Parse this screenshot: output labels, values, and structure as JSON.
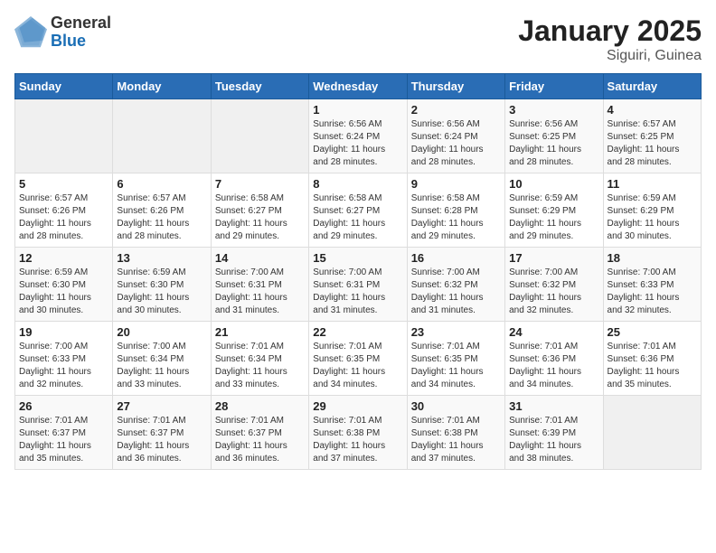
{
  "header": {
    "logo_general": "General",
    "logo_blue": "Blue",
    "title": "January 2025",
    "subtitle": "Siguiri, Guinea"
  },
  "calendar": {
    "days_of_week": [
      "Sunday",
      "Monday",
      "Tuesday",
      "Wednesday",
      "Thursday",
      "Friday",
      "Saturday"
    ],
    "weeks": [
      [
        {
          "num": "",
          "info": ""
        },
        {
          "num": "",
          "info": ""
        },
        {
          "num": "",
          "info": ""
        },
        {
          "num": "1",
          "info": "Sunrise: 6:56 AM\nSunset: 6:24 PM\nDaylight: 11 hours\nand 28 minutes."
        },
        {
          "num": "2",
          "info": "Sunrise: 6:56 AM\nSunset: 6:24 PM\nDaylight: 11 hours\nand 28 minutes."
        },
        {
          "num": "3",
          "info": "Sunrise: 6:56 AM\nSunset: 6:25 PM\nDaylight: 11 hours\nand 28 minutes."
        },
        {
          "num": "4",
          "info": "Sunrise: 6:57 AM\nSunset: 6:25 PM\nDaylight: 11 hours\nand 28 minutes."
        }
      ],
      [
        {
          "num": "5",
          "info": "Sunrise: 6:57 AM\nSunset: 6:26 PM\nDaylight: 11 hours\nand 28 minutes."
        },
        {
          "num": "6",
          "info": "Sunrise: 6:57 AM\nSunset: 6:26 PM\nDaylight: 11 hours\nand 28 minutes."
        },
        {
          "num": "7",
          "info": "Sunrise: 6:58 AM\nSunset: 6:27 PM\nDaylight: 11 hours\nand 29 minutes."
        },
        {
          "num": "8",
          "info": "Sunrise: 6:58 AM\nSunset: 6:27 PM\nDaylight: 11 hours\nand 29 minutes."
        },
        {
          "num": "9",
          "info": "Sunrise: 6:58 AM\nSunset: 6:28 PM\nDaylight: 11 hours\nand 29 minutes."
        },
        {
          "num": "10",
          "info": "Sunrise: 6:59 AM\nSunset: 6:29 PM\nDaylight: 11 hours\nand 29 minutes."
        },
        {
          "num": "11",
          "info": "Sunrise: 6:59 AM\nSunset: 6:29 PM\nDaylight: 11 hours\nand 30 minutes."
        }
      ],
      [
        {
          "num": "12",
          "info": "Sunrise: 6:59 AM\nSunset: 6:30 PM\nDaylight: 11 hours\nand 30 minutes."
        },
        {
          "num": "13",
          "info": "Sunrise: 6:59 AM\nSunset: 6:30 PM\nDaylight: 11 hours\nand 30 minutes."
        },
        {
          "num": "14",
          "info": "Sunrise: 7:00 AM\nSunset: 6:31 PM\nDaylight: 11 hours\nand 31 minutes."
        },
        {
          "num": "15",
          "info": "Sunrise: 7:00 AM\nSunset: 6:31 PM\nDaylight: 11 hours\nand 31 minutes."
        },
        {
          "num": "16",
          "info": "Sunrise: 7:00 AM\nSunset: 6:32 PM\nDaylight: 11 hours\nand 31 minutes."
        },
        {
          "num": "17",
          "info": "Sunrise: 7:00 AM\nSunset: 6:32 PM\nDaylight: 11 hours\nand 32 minutes."
        },
        {
          "num": "18",
          "info": "Sunrise: 7:00 AM\nSunset: 6:33 PM\nDaylight: 11 hours\nand 32 minutes."
        }
      ],
      [
        {
          "num": "19",
          "info": "Sunrise: 7:00 AM\nSunset: 6:33 PM\nDaylight: 11 hours\nand 32 minutes."
        },
        {
          "num": "20",
          "info": "Sunrise: 7:00 AM\nSunset: 6:34 PM\nDaylight: 11 hours\nand 33 minutes."
        },
        {
          "num": "21",
          "info": "Sunrise: 7:01 AM\nSunset: 6:34 PM\nDaylight: 11 hours\nand 33 minutes."
        },
        {
          "num": "22",
          "info": "Sunrise: 7:01 AM\nSunset: 6:35 PM\nDaylight: 11 hours\nand 34 minutes."
        },
        {
          "num": "23",
          "info": "Sunrise: 7:01 AM\nSunset: 6:35 PM\nDaylight: 11 hours\nand 34 minutes."
        },
        {
          "num": "24",
          "info": "Sunrise: 7:01 AM\nSunset: 6:36 PM\nDaylight: 11 hours\nand 34 minutes."
        },
        {
          "num": "25",
          "info": "Sunrise: 7:01 AM\nSunset: 6:36 PM\nDaylight: 11 hours\nand 35 minutes."
        }
      ],
      [
        {
          "num": "26",
          "info": "Sunrise: 7:01 AM\nSunset: 6:37 PM\nDaylight: 11 hours\nand 35 minutes."
        },
        {
          "num": "27",
          "info": "Sunrise: 7:01 AM\nSunset: 6:37 PM\nDaylight: 11 hours\nand 36 minutes."
        },
        {
          "num": "28",
          "info": "Sunrise: 7:01 AM\nSunset: 6:37 PM\nDaylight: 11 hours\nand 36 minutes."
        },
        {
          "num": "29",
          "info": "Sunrise: 7:01 AM\nSunset: 6:38 PM\nDaylight: 11 hours\nand 37 minutes."
        },
        {
          "num": "30",
          "info": "Sunrise: 7:01 AM\nSunset: 6:38 PM\nDaylight: 11 hours\nand 37 minutes."
        },
        {
          "num": "31",
          "info": "Sunrise: 7:01 AM\nSunset: 6:39 PM\nDaylight: 11 hours\nand 38 minutes."
        },
        {
          "num": "",
          "info": ""
        }
      ]
    ]
  }
}
